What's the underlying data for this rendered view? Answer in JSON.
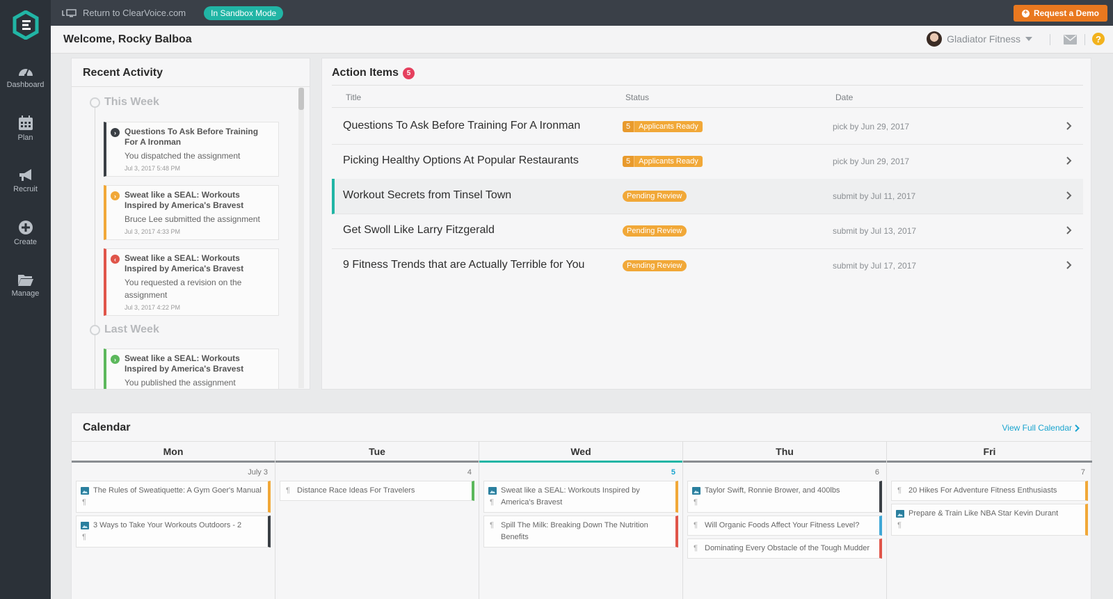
{
  "nav": {
    "items": [
      {
        "label": "Dashboard",
        "icon": "dashboard-icon"
      },
      {
        "label": "Plan",
        "icon": "calendar-icon"
      },
      {
        "label": "Recruit",
        "icon": "megaphone-icon"
      },
      {
        "label": "Create",
        "icon": "plus-circle-icon"
      },
      {
        "label": "Manage",
        "icon": "folder-icon"
      }
    ]
  },
  "topbar": {
    "return_label": "Return to ClearVoice.com",
    "sandbox_label": "In Sandbox Mode",
    "demo_label": "Request a Demo"
  },
  "header": {
    "welcome": "Welcome, Rocky Balboa",
    "account_name": "Gladiator Fitness",
    "help_label": "?"
  },
  "recent": {
    "title": "Recent Activity",
    "week_this": "This Week",
    "week_last": "Last Week",
    "items": [
      {
        "title": "Questions To Ask Before Training For A Ironman",
        "desc": "You dispatched the assignment",
        "time": "Jul 3, 2017 5:48 PM"
      },
      {
        "title": "Sweat like a SEAL: Workouts Inspired by America's Bravest",
        "desc": "Bruce Lee submitted the assignment",
        "time": "Jul 3, 2017 4:33 PM"
      },
      {
        "title": "Sweat like a SEAL: Workouts Inspired by America's Bravest",
        "desc": "You requested a revision on the assignment",
        "time": "Jul 3, 2017 4:22 PM"
      },
      {
        "title": "Sweat like a SEAL: Workouts Inspired by America's Bravest",
        "desc": "You published the assignment",
        "time": ""
      }
    ]
  },
  "actions": {
    "title": "Action Items",
    "count": "5",
    "columns": {
      "title": "Title",
      "status": "Status",
      "date": "Date"
    },
    "rows": [
      {
        "title": "Questions To Ask Before Training For A Ironman",
        "status_count": "5",
        "status": "Applicants Ready",
        "date": "pick by Jun 29, 2017"
      },
      {
        "title": "Picking Healthy Options At Popular Restaurants",
        "status_count": "5",
        "status": "Applicants Ready",
        "date": "pick by Jun 29, 2017"
      },
      {
        "title": "Workout Secrets from Tinsel Town",
        "status": "Pending Review",
        "date": "submit by Jul 11, 2017"
      },
      {
        "title": "Get Swoll Like Larry Fitzgerald",
        "status": "Pending Review",
        "date": "submit by Jul 13, 2017"
      },
      {
        "title": "9 Fitness Trends that are Actually Terrible for You",
        "status": "Pending Review",
        "date": "submit by Jul 17, 2017"
      }
    ]
  },
  "calendar": {
    "title": "Calendar",
    "view_full": "View Full Calendar",
    "days": [
      {
        "name": "Mon",
        "date": "July 3",
        "events": [
          {
            "text": "The Rules of Sweatiquette: A Gym Goer's Manual"
          },
          {
            "text": "3 Ways to Take Your Workouts Outdoors - 2"
          }
        ]
      },
      {
        "name": "Tue",
        "date": "4",
        "events": [
          {
            "text": "Distance Race Ideas For Travelers"
          }
        ]
      },
      {
        "name": "Wed",
        "date": "5",
        "events": [
          {
            "text": "Sweat like a SEAL: Workouts Inspired by America's Bravest"
          },
          {
            "text": "Spill The Milk: Breaking Down The Nutrition Benefits"
          }
        ]
      },
      {
        "name": "Thu",
        "date": "6",
        "events": [
          {
            "text": "Taylor Swift, Ronnie Brower, and 400lbs"
          },
          {
            "text": "Will Organic Foods Affect Your Fitness Level?"
          },
          {
            "text": "Dominating Every Obstacle of the Tough Mudder"
          }
        ]
      },
      {
        "name": "Fri",
        "date": "7",
        "events": [
          {
            "text": "20 Hikes For Adventure Fitness Enthusiasts"
          },
          {
            "text": "Prepare & Train Like NBA Star Kevin Durant"
          }
        ]
      }
    ]
  },
  "colors": {
    "accent": "#21b5a5",
    "orange": "#e9781f",
    "badge_red": "#e5405e",
    "status_orange": "#f1a838",
    "link_blue": "#1aa4cf"
  }
}
